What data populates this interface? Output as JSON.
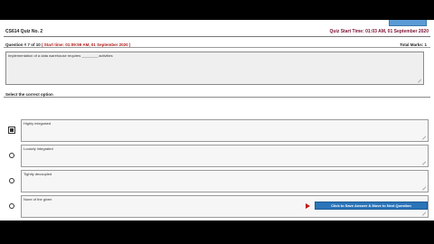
{
  "header": {
    "quiz_title": "CS614 Quiz No. 2",
    "start_time": "Quiz Start Time: 01:03 AM, 01 September 2020"
  },
  "question": {
    "number_label": "Question # 7 of 10",
    "due_label": "( Start time: 01:09:59 AM, 01 September 2020 )",
    "total_marks": "Total Marks: 1",
    "text": "Implementation of a data warehouse requires ________ activities"
  },
  "options_label": "Select the correct option",
  "options": [
    {
      "text": "Highly integrated",
      "selected": true
    },
    {
      "text": "Loosely integrated",
      "selected": false
    },
    {
      "text": "Tightly decoupled",
      "selected": false
    },
    {
      "text": "None of the given",
      "selected": false
    }
  ],
  "next_button_label": "Click to Save Answer & Move to Next Question"
}
